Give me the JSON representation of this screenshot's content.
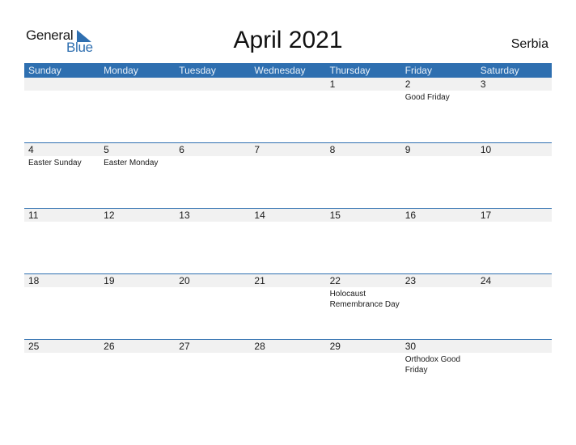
{
  "logo": {
    "part1": "General",
    "part2": "Blue"
  },
  "title": "April 2021",
  "country": "Serbia",
  "colors": {
    "accent": "#2e6fb0",
    "band": "#f1f1f1"
  },
  "weekdays": [
    "Sunday",
    "Monday",
    "Tuesday",
    "Wednesday",
    "Thursday",
    "Friday",
    "Saturday"
  ],
  "weeks": [
    {
      "days": [
        {
          "num": "",
          "holiday": ""
        },
        {
          "num": "",
          "holiday": ""
        },
        {
          "num": "",
          "holiday": ""
        },
        {
          "num": "",
          "holiday": ""
        },
        {
          "num": "1",
          "holiday": ""
        },
        {
          "num": "2",
          "holiday": "Good Friday"
        },
        {
          "num": "3",
          "holiday": ""
        }
      ]
    },
    {
      "days": [
        {
          "num": "4",
          "holiday": "Easter Sunday"
        },
        {
          "num": "5",
          "holiday": "Easter Monday"
        },
        {
          "num": "6",
          "holiday": ""
        },
        {
          "num": "7",
          "holiday": ""
        },
        {
          "num": "8",
          "holiday": ""
        },
        {
          "num": "9",
          "holiday": ""
        },
        {
          "num": "10",
          "holiday": ""
        }
      ]
    },
    {
      "days": [
        {
          "num": "11",
          "holiday": ""
        },
        {
          "num": "12",
          "holiday": ""
        },
        {
          "num": "13",
          "holiday": ""
        },
        {
          "num": "14",
          "holiday": ""
        },
        {
          "num": "15",
          "holiday": ""
        },
        {
          "num": "16",
          "holiday": ""
        },
        {
          "num": "17",
          "holiday": ""
        }
      ]
    },
    {
      "days": [
        {
          "num": "18",
          "holiday": ""
        },
        {
          "num": "19",
          "holiday": ""
        },
        {
          "num": "20",
          "holiday": ""
        },
        {
          "num": "21",
          "holiday": ""
        },
        {
          "num": "22",
          "holiday": "Holocaust Remembrance Day"
        },
        {
          "num": "23",
          "holiday": ""
        },
        {
          "num": "24",
          "holiday": ""
        }
      ]
    },
    {
      "days": [
        {
          "num": "25",
          "holiday": ""
        },
        {
          "num": "26",
          "holiday": ""
        },
        {
          "num": "27",
          "holiday": ""
        },
        {
          "num": "28",
          "holiday": ""
        },
        {
          "num": "29",
          "holiday": ""
        },
        {
          "num": "30",
          "holiday": "Orthodox Good Friday"
        },
        {
          "num": "",
          "holiday": ""
        }
      ]
    }
  ]
}
